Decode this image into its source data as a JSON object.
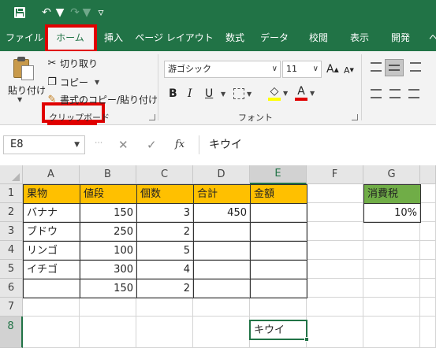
{
  "quick_access": {
    "save": "save-icon",
    "undo": "undo-icon",
    "redo": "redo-icon",
    "customize": "customize-icon"
  },
  "tabs": [
    "ファイル",
    "ホーム",
    "挿入",
    "ページ レイアウト",
    "数式",
    "データ",
    "校閲",
    "表示",
    "開発",
    "ヘ"
  ],
  "ribbon": {
    "clipboard": {
      "paste": "貼り付け",
      "cut": "切り取り",
      "copy": "コピー",
      "format_painter": "書式のコピー/貼り付け",
      "group_label": "クリップボード"
    },
    "font": {
      "font_name": "游ゴシック",
      "font_size": "11",
      "grow": "A",
      "shrink": "A",
      "bold": "B",
      "italic": "I",
      "underline": "U",
      "font_color": "A",
      "group_label": "フォント"
    }
  },
  "formula_bar": {
    "name_box": "E8",
    "fx": "fx",
    "value": "キウイ"
  },
  "columns": [
    "A",
    "B",
    "C",
    "D",
    "E",
    "F",
    "G"
  ],
  "rows": [
    "1",
    "2",
    "3",
    "4",
    "5",
    "6",
    "7",
    "8"
  ],
  "table": {
    "headers": [
      "果物",
      "値段",
      "個数",
      "合計",
      "金額"
    ],
    "data": [
      [
        "バナナ",
        "150",
        "3",
        "450",
        ""
      ],
      [
        "ブドウ",
        "250",
        "2",
        "",
        ""
      ],
      [
        "リンゴ",
        "100",
        "5",
        "",
        ""
      ],
      [
        "イチゴ",
        "300",
        "4",
        "",
        ""
      ],
      [
        "",
        "150",
        "2",
        "",
        ""
      ]
    ]
  },
  "tax": {
    "header": "消費税",
    "value": "10%"
  },
  "e8_value": "キウイ",
  "colors": {
    "excel_green": "#217346",
    "header_yellow": "#ffc000",
    "tax_green": "#70ad47",
    "highlight_red": "#e00000"
  }
}
